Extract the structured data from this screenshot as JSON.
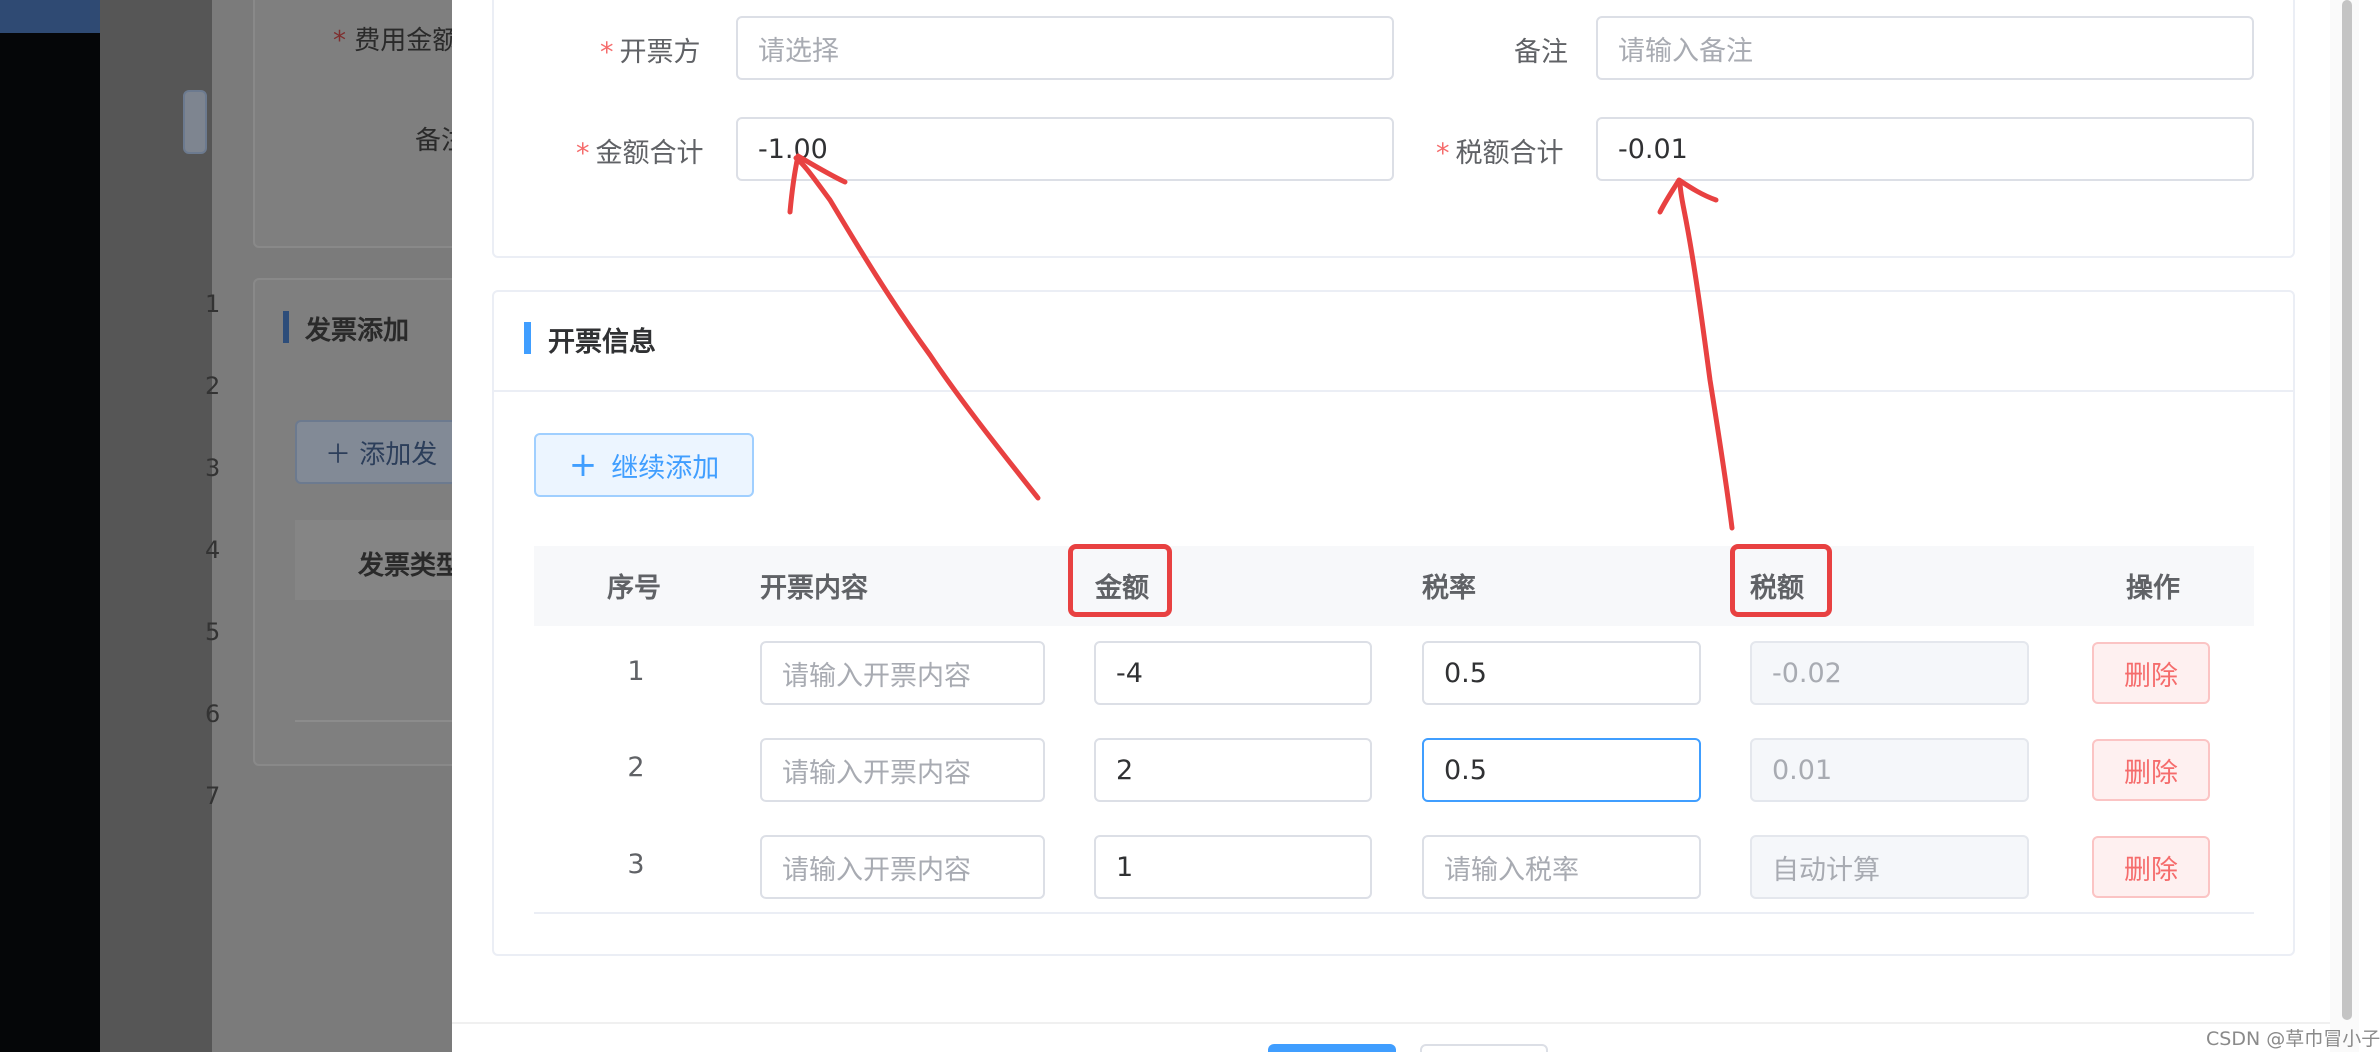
{
  "background": {
    "fee_amount_label": "费用金额",
    "remark_label": "备注",
    "invoice_add_title": "发票添加",
    "add_invoice_button": "添加发",
    "invoice_type_header": "发票类型",
    "row_numbers": [
      "1",
      "2",
      "3",
      "4",
      "5",
      "6",
      "7"
    ]
  },
  "form": {
    "issuer": {
      "label": "开票方",
      "placeholder": "请选择"
    },
    "remark": {
      "label": "备注",
      "placeholder": "请输入备注"
    },
    "amount_total": {
      "label": "金额合计",
      "value": "-1.00"
    },
    "tax_total": {
      "label": "税额合计",
      "value": "-0.01"
    },
    "required_mark": "*"
  },
  "invoice_section": {
    "title": "开票信息",
    "add_button": "继续添加",
    "columns": [
      "序号",
      "开票内容",
      "金额",
      "税率",
      "税额",
      "操作"
    ],
    "content_placeholder": "请输入开票内容",
    "rate_placeholder": "请输入税率",
    "rows": [
      {
        "index": "1",
        "amount": "-4",
        "rate": "0.5",
        "tax": "-0.02",
        "action": "删除"
      },
      {
        "index": "2",
        "amount": "2",
        "rate": "0.5",
        "tax": "0.01",
        "action": "删除"
      },
      {
        "index": "3",
        "amount": "1",
        "rate": "",
        "tax": "自动计算",
        "action": "删除"
      }
    ]
  },
  "colors": {
    "primary": "#409eff",
    "danger": "#f56c6c",
    "annotation_red": "#e84141"
  },
  "watermark": "CSDN @草巾冒小子"
}
